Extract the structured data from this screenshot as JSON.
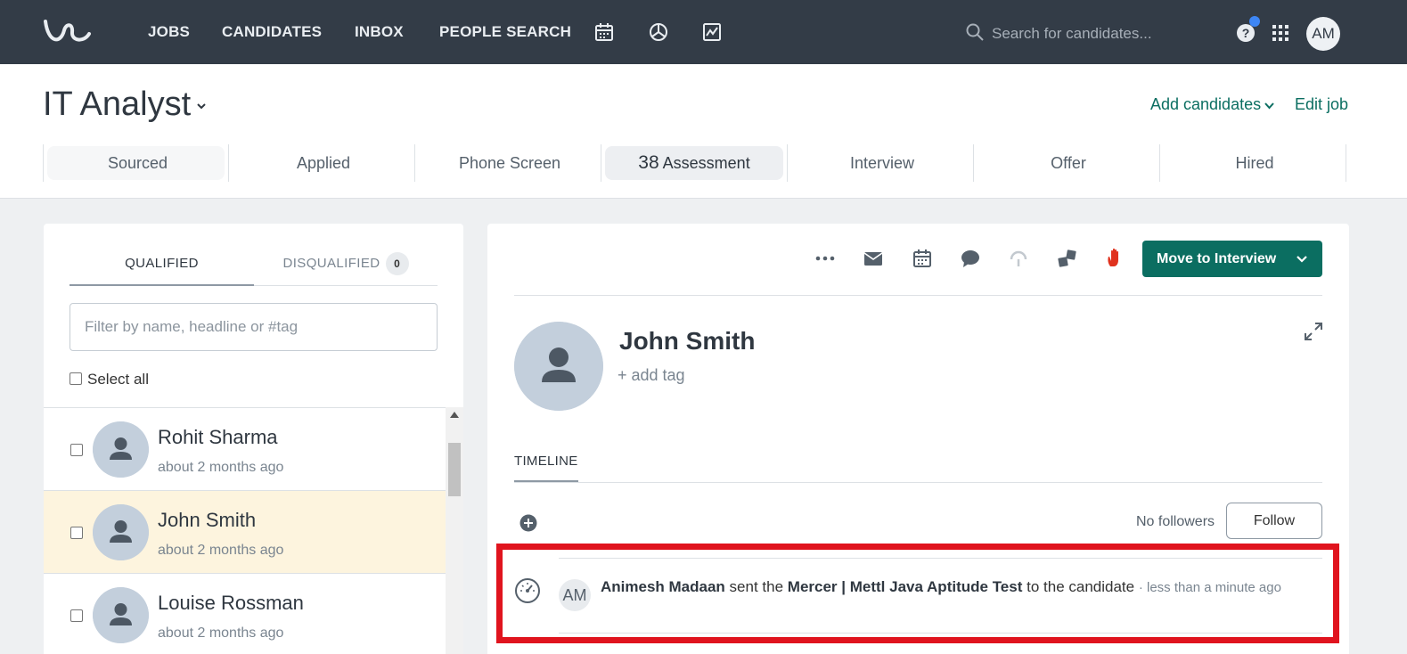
{
  "topbar": {
    "nav": [
      "JOBS",
      "CANDIDATES",
      "INBOX",
      "PEOPLE SEARCH"
    ],
    "search_placeholder": "Search for candidates...",
    "user_initials": "AM"
  },
  "job": {
    "title": "IT Analyst",
    "add_candidates": "Add candidates",
    "edit_job": "Edit job"
  },
  "stages": [
    {
      "label": "Sourced",
      "count": ""
    },
    {
      "label": "Applied",
      "count": ""
    },
    {
      "label": "Phone Screen",
      "count": ""
    },
    {
      "label": "Assessment",
      "count": "38"
    },
    {
      "label": "Interview",
      "count": ""
    },
    {
      "label": "Offer",
      "count": ""
    },
    {
      "label": "Hired",
      "count": ""
    }
  ],
  "candidates_panel": {
    "tab_qualified": "QUALIFIED",
    "tab_disqualified": "DISQUALIFIED",
    "disqualified_count": "0",
    "filter_placeholder": "Filter by name, headline or #tag",
    "select_all": "Select all",
    "candidates": [
      {
        "name": "Rohit Sharma",
        "time": "about 2 months ago"
      },
      {
        "name": "John Smith",
        "time": "about 2 months ago"
      },
      {
        "name": "Louise Rossman",
        "time": "about 2 months ago"
      }
    ]
  },
  "profile": {
    "move_button": "Move to Interview",
    "name": "John Smith",
    "add_tag": "+ add tag",
    "timeline_tab": "TIMELINE",
    "followers": "No followers",
    "follow_button": "Follow",
    "event": {
      "avatar_initials": "AM",
      "actor": "Animesh Madaan",
      "verb": "sent the",
      "object": "Mercer | Mettl Java Aptitude Test",
      "suffix": "to the candidate",
      "time": "· less than a minute ago"
    }
  },
  "colors": {
    "topbar": "#333c47",
    "brand_green": "#0b6e61",
    "highlight_red": "#e0141e",
    "selected_row": "#fdf4de"
  }
}
